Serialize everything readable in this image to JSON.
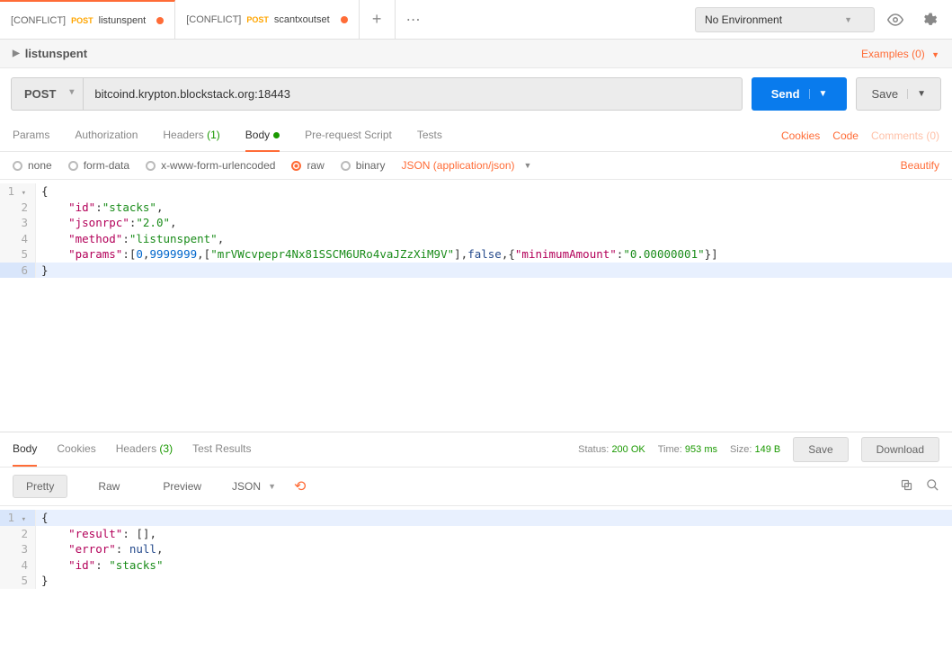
{
  "tabs": [
    {
      "prefix": "[CONFLICT]",
      "method": "POST",
      "name": "listunspent",
      "active": true
    },
    {
      "prefix": "[CONFLICT]",
      "method": "POST",
      "name": "scantxoutset",
      "active": false
    }
  ],
  "environment": {
    "label": "No Environment"
  },
  "breadcrumb": {
    "name": "listunspent"
  },
  "examples": {
    "label": "Examples (0)"
  },
  "request": {
    "method": "POST",
    "url": "bitcoind.krypton.blockstack.org:18443",
    "send_label": "Send",
    "save_label": "Save"
  },
  "req_tabs": {
    "params": "Params",
    "authorization": "Authorization",
    "headers": "Headers",
    "headers_count": "(1)",
    "body": "Body",
    "prescript": "Pre-request Script",
    "tests": "Tests"
  },
  "right_links": {
    "cookies": "Cookies",
    "code": "Code",
    "comments": "Comments (0)"
  },
  "body_options": {
    "none": "none",
    "form_data": "form-data",
    "urlencoded": "x-www-form-urlencoded",
    "raw": "raw",
    "binary": "binary",
    "content_type": "JSON (application/json)",
    "beautify": "Beautify"
  },
  "request_body": {
    "id_key": "\"id\"",
    "id_val": "\"stacks\"",
    "jsonrpc_key": "\"jsonrpc\"",
    "jsonrpc_val": "\"2.0\"",
    "method_key": "\"method\"",
    "method_val": "\"listunspent\"",
    "params_key": "\"params\"",
    "params_arr_open": ":[",
    "params_n1": "0",
    "params_n2": "9999999",
    "params_addr": "\"mrVWcvpepr4Nx81SSCM6URo4vaJZzXiM9V\"",
    "params_bool": "false",
    "params_minamt_key": "\"minimumAmount\"",
    "params_minamt_val": "\"0.00000001\""
  },
  "resp_tabs": {
    "body": "Body",
    "cookies": "Cookies",
    "headers": "Headers",
    "headers_count": "(3)",
    "test_results": "Test Results"
  },
  "resp_meta": {
    "status_label": "Status:",
    "status_val": "200 OK",
    "time_label": "Time:",
    "time_val": "953 ms",
    "size_label": "Size:",
    "size_val": "149 B",
    "save_label": "Save",
    "download_label": "Download"
  },
  "resp_view": {
    "pretty": "Pretty",
    "raw": "Raw",
    "preview": "Preview",
    "format": "JSON"
  },
  "response_body": {
    "result_key": "\"result\"",
    "result_val": "[]",
    "error_key": "\"error\"",
    "error_val": "null",
    "id_key": "\"id\"",
    "id_val": "\"stacks\""
  }
}
